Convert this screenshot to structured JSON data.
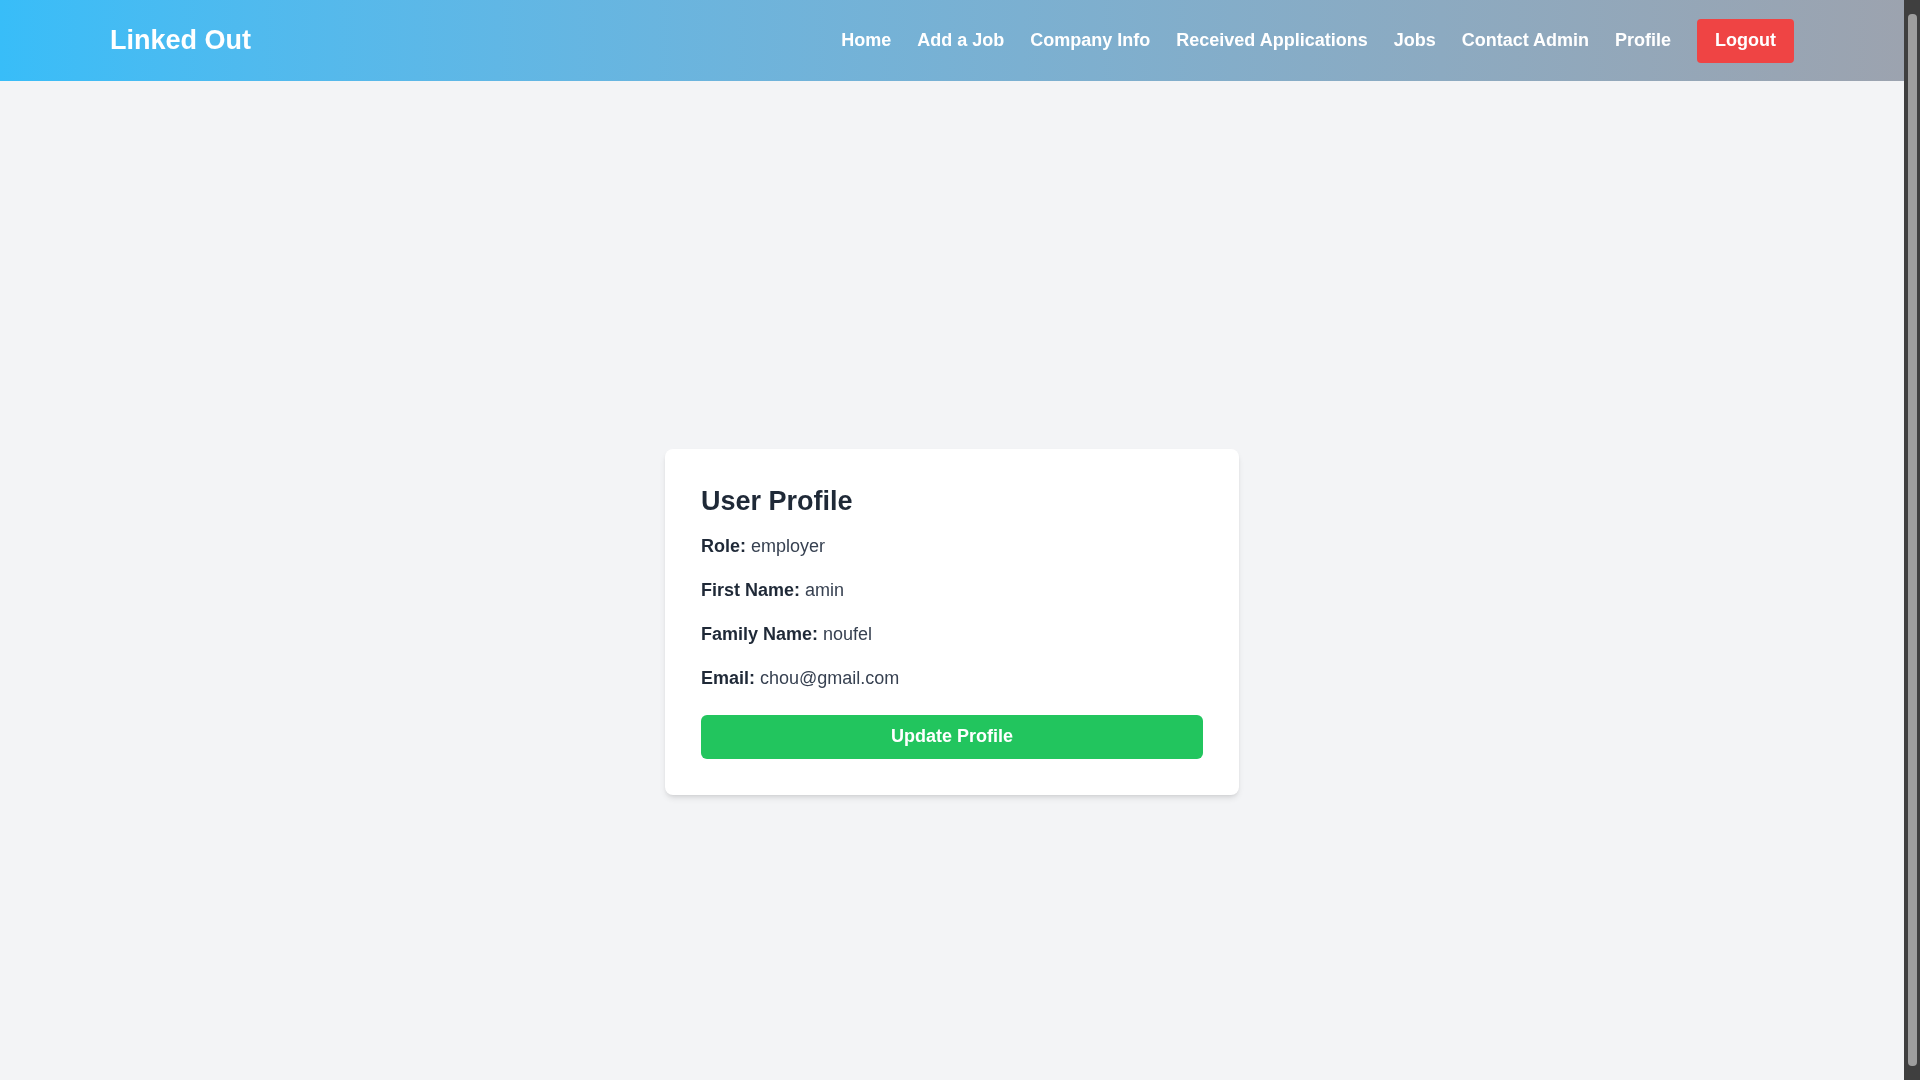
{
  "header": {
    "logo": "Linked Out",
    "nav": [
      {
        "label": "Home",
        "kind": "link"
      },
      {
        "label": "Add a Job",
        "kind": "link"
      },
      {
        "label": "Company Info",
        "kind": "link"
      },
      {
        "label": "Received Applications",
        "kind": "link"
      },
      {
        "label": "Jobs",
        "kind": "link"
      },
      {
        "label": "Contact Admin",
        "kind": "link"
      },
      {
        "label": "Profile",
        "kind": "link"
      },
      {
        "label": "Logout",
        "kind": "button"
      }
    ]
  },
  "profile": {
    "title": "User Profile",
    "fields": [
      "**Role:** employer",
      "**First Name:** amin",
      "**Family Name:** noufel",
      "**Email:** chou@gmail.com"
    ],
    "button": "Update Profile"
  }
}
